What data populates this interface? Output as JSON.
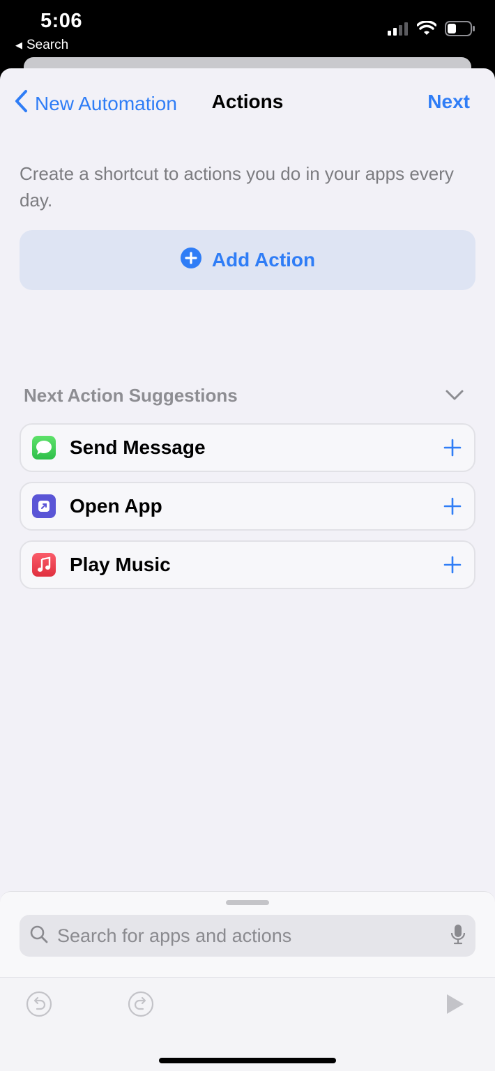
{
  "status_bar": {
    "time": "5:06",
    "back_label": "Search",
    "icons": [
      "signal-icon",
      "wifi-icon",
      "battery-icon"
    ]
  },
  "nav": {
    "back_label": "New Automation",
    "title": "Actions",
    "next_label": "Next"
  },
  "intro_text": "Create a shortcut to actions you do in your apps every day.",
  "add_action": {
    "label": "Add Action",
    "icon": "plus-circle-icon"
  },
  "suggestions": {
    "title": "Next Action Suggestions",
    "items": [
      {
        "label": "Send Message",
        "icon": "messages-icon",
        "color": "#34c759"
      },
      {
        "label": "Open App",
        "icon": "open-app-icon",
        "color": "#5a55d6"
      },
      {
        "label": "Play Music",
        "icon": "music-icon",
        "color": "#f0424f"
      }
    ]
  },
  "search": {
    "placeholder": "Search for apps and actions"
  },
  "colors": {
    "accent": "#2f7df6",
    "background": "#f2f1f7",
    "add_action_bg": "#dee4f3"
  }
}
